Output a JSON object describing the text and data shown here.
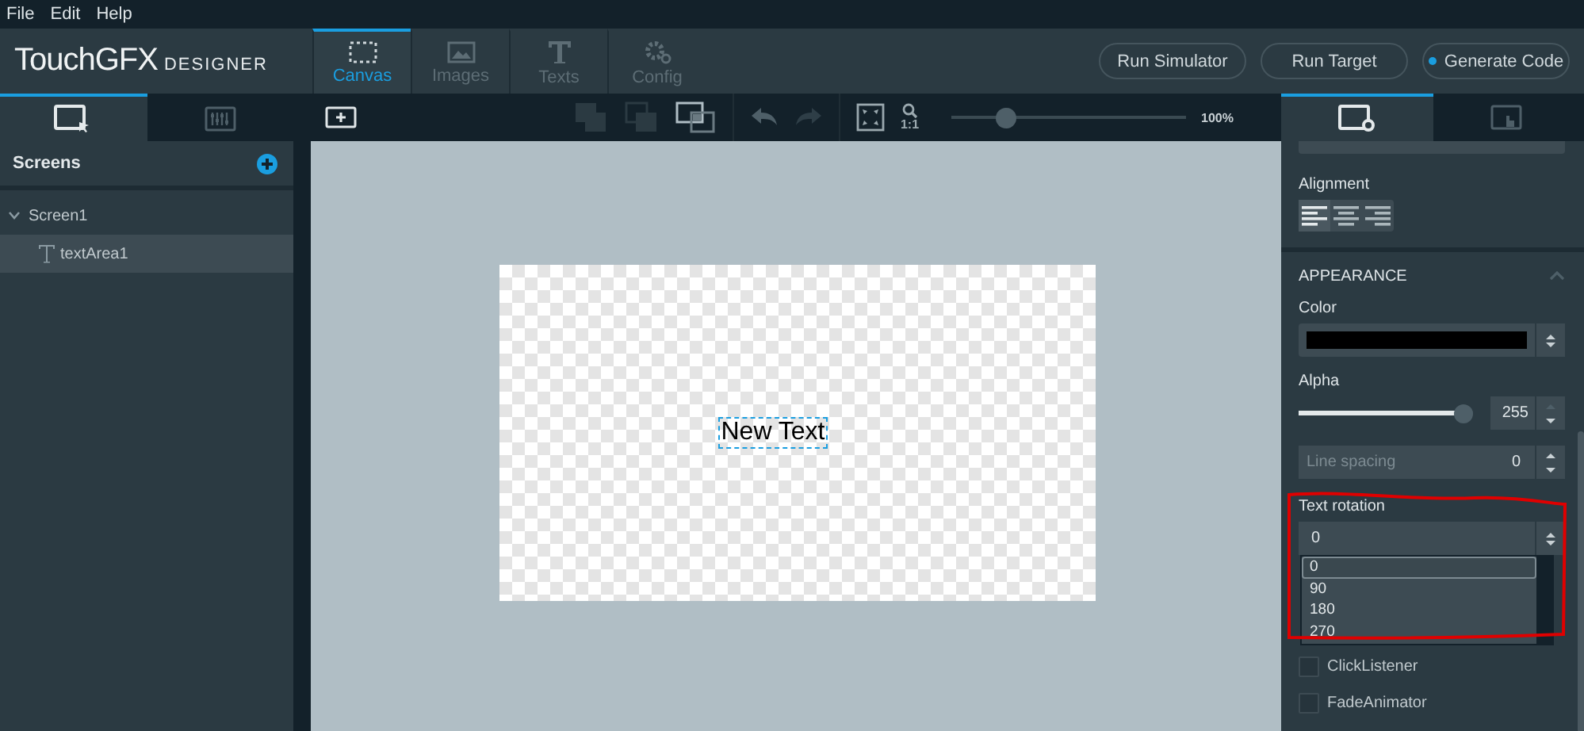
{
  "menu": [
    "File",
    "Edit",
    "Help"
  ],
  "logo": {
    "name": "TouchGFX",
    "sub": "DESIGNER"
  },
  "main_tabs": [
    {
      "label": "Canvas",
      "selected": true
    },
    {
      "label": "Images",
      "selected": false
    },
    {
      "label": "Texts",
      "selected": false
    },
    {
      "label": "Config",
      "selected": false
    }
  ],
  "actions": [
    {
      "label": "Run Simulator",
      "dot": false
    },
    {
      "label": "Run Target",
      "dot": false
    },
    {
      "label": "Generate Code",
      "dot": true
    }
  ],
  "left_tabs": [
    {
      "selected": true
    },
    {
      "selected": false
    }
  ],
  "screens": {
    "title": "Screens",
    "tree": [
      {
        "label": "Screen1",
        "expanded": true,
        "selected": false,
        "children": [
          {
            "label": "textArea1",
            "selected": true
          }
        ]
      }
    ]
  },
  "toolbar": {
    "zoom": {
      "level": 0.23,
      "reading": "100%"
    },
    "fit_label": "1:1"
  },
  "canvas": {
    "text": "New Text"
  },
  "right_tabs": [
    {
      "selected": true
    },
    {
      "selected": false
    }
  ],
  "properties": {
    "alignment": {
      "label": "Alignment",
      "options": [
        {
          "kind": "left",
          "selected": true
        },
        {
          "kind": "center",
          "selected": false
        },
        {
          "kind": "right",
          "selected": false
        }
      ]
    },
    "appearance": {
      "title": "APPEARANCE",
      "expanded": true,
      "color_label": "Color",
      "color": "#000000",
      "alpha_label": "Alpha",
      "alpha": {
        "level": 1.0
      },
      "alpha_value": "255",
      "line_spacing": {
        "placeholder": "Line spacing",
        "value": "0"
      },
      "rotation_label": "Text rotation",
      "rotation_value": "0",
      "rotation_options": [
        {
          "label": "0",
          "selected": true
        },
        {
          "label": "90",
          "selected": false
        },
        {
          "label": "180",
          "selected": false
        },
        {
          "label": "270",
          "selected": false
        }
      ]
    },
    "mixins": [
      {
        "label": "ClickListener",
        "checked": false
      },
      {
        "label": "FadeAnimator",
        "checked": false
      }
    ]
  }
}
